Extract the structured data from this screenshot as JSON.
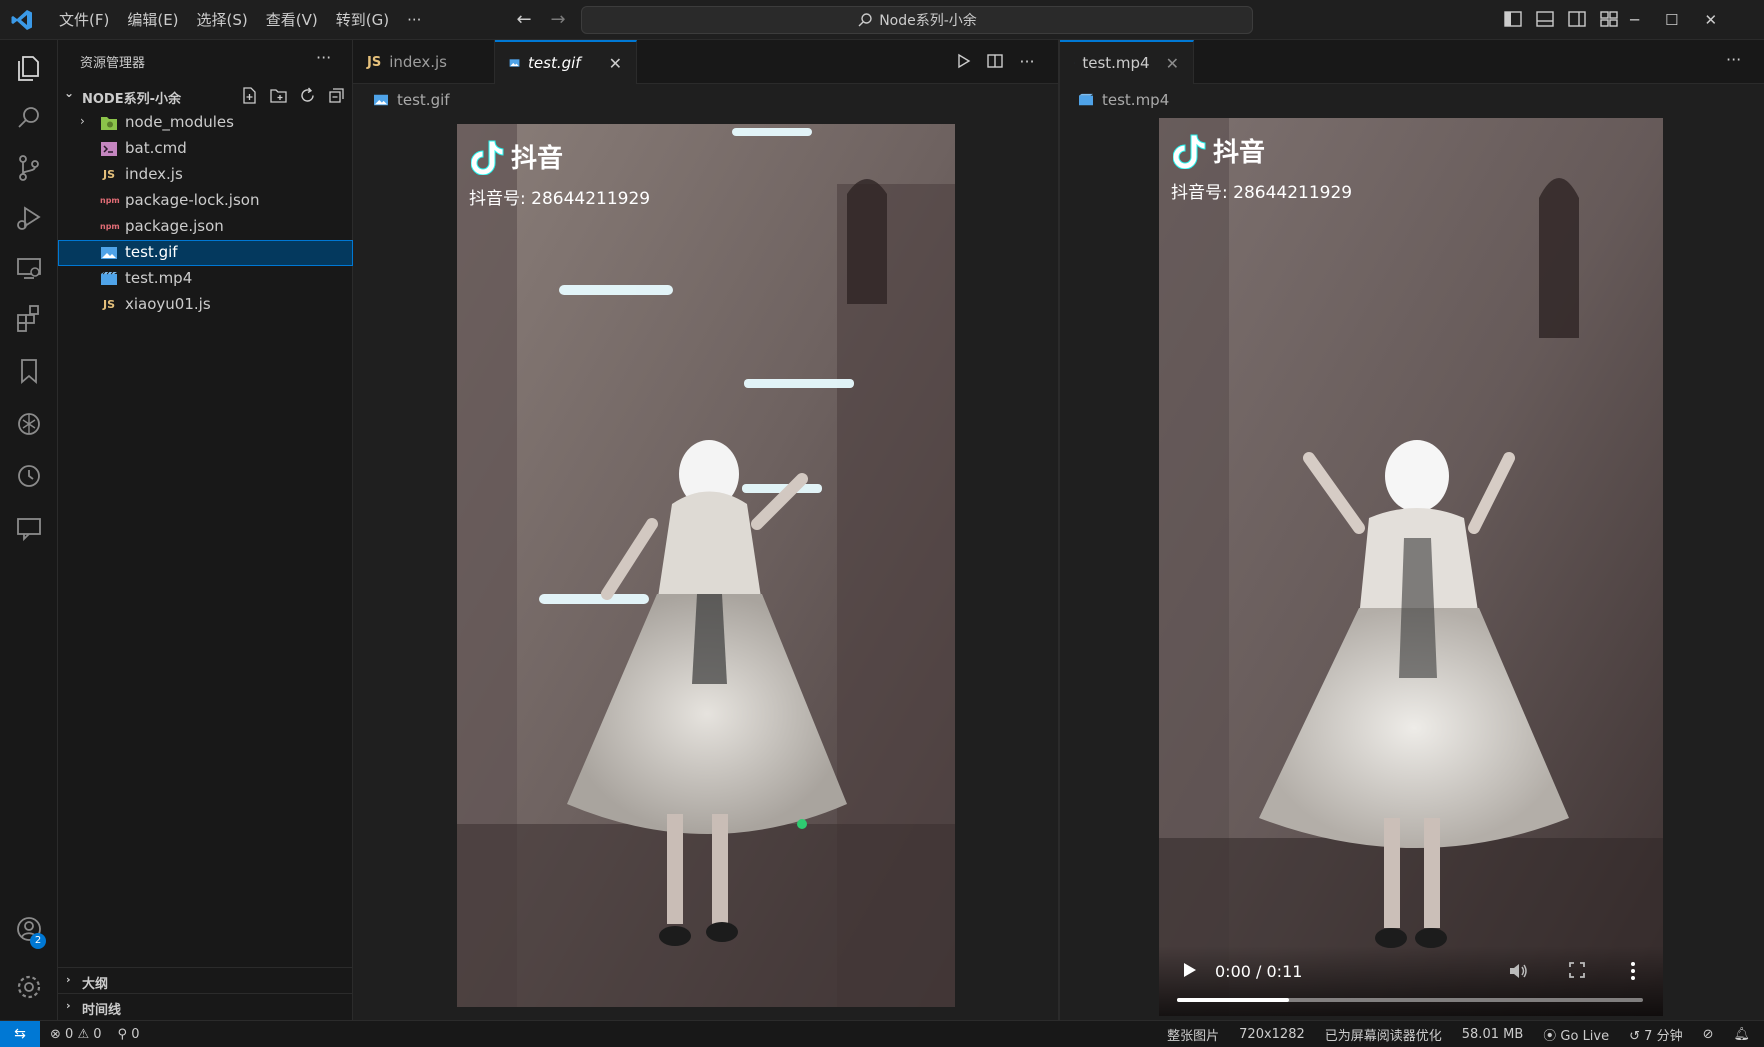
{
  "titlebar": {
    "menu": [
      "文件(F)",
      "编辑(E)",
      "选择(S)",
      "查看(V)",
      "转到(G)",
      "···"
    ],
    "command_center": "Node系列-小余"
  },
  "sidebar": {
    "title": "资源管理器",
    "folder": "NODE系列-小余",
    "items": [
      {
        "label": "node_modules",
        "icon": "folder-icon",
        "type": "folder"
      },
      {
        "label": "bat.cmd",
        "icon": "cmd-icon",
        "type": "file"
      },
      {
        "label": "index.js",
        "icon": "js-icon",
        "type": "file"
      },
      {
        "label": "package-lock.json",
        "icon": "npm-icon",
        "type": "file"
      },
      {
        "label": "package.json",
        "icon": "npm-icon",
        "type": "file"
      },
      {
        "label": "test.gif",
        "icon": "image-icon",
        "type": "file",
        "selected": true
      },
      {
        "label": "test.mp4",
        "icon": "video-icon",
        "type": "file"
      },
      {
        "label": "xiaoyu01.js",
        "icon": "js-icon",
        "type": "file"
      }
    ],
    "sections": [
      "大纲",
      "时间线"
    ],
    "js_glyph": "JS",
    "npm_glyph": "npm"
  },
  "editor_left": {
    "tabs": [
      {
        "label": "index.js",
        "active": false
      },
      {
        "label": "test.gif",
        "active": true
      }
    ],
    "breadcrumb": "test.gif",
    "brand": "抖音",
    "douyin_id": "抖音号: 28644211929"
  },
  "editor_right": {
    "tabs": [
      {
        "label": "test.mp4",
        "active": true
      }
    ],
    "breadcrumb": "test.mp4",
    "brand": "抖音",
    "douyin_id": "抖音号: 28644211929",
    "video": {
      "time": "0:00 / 0:11",
      "progress_fraction": 0.24
    }
  },
  "accounts_badge": "2",
  "statusbar": {
    "errors": "0",
    "warnings": "0",
    "ports": "0",
    "items": [
      "整张图片",
      "720x1282",
      "已为屏幕阅读器优化",
      "58.01 MB",
      "Go Live",
      "7 分钟"
    ]
  },
  "colors": {
    "accent": "#0078d4",
    "selection": "#04395e",
    "background": "#1f1f1f"
  }
}
